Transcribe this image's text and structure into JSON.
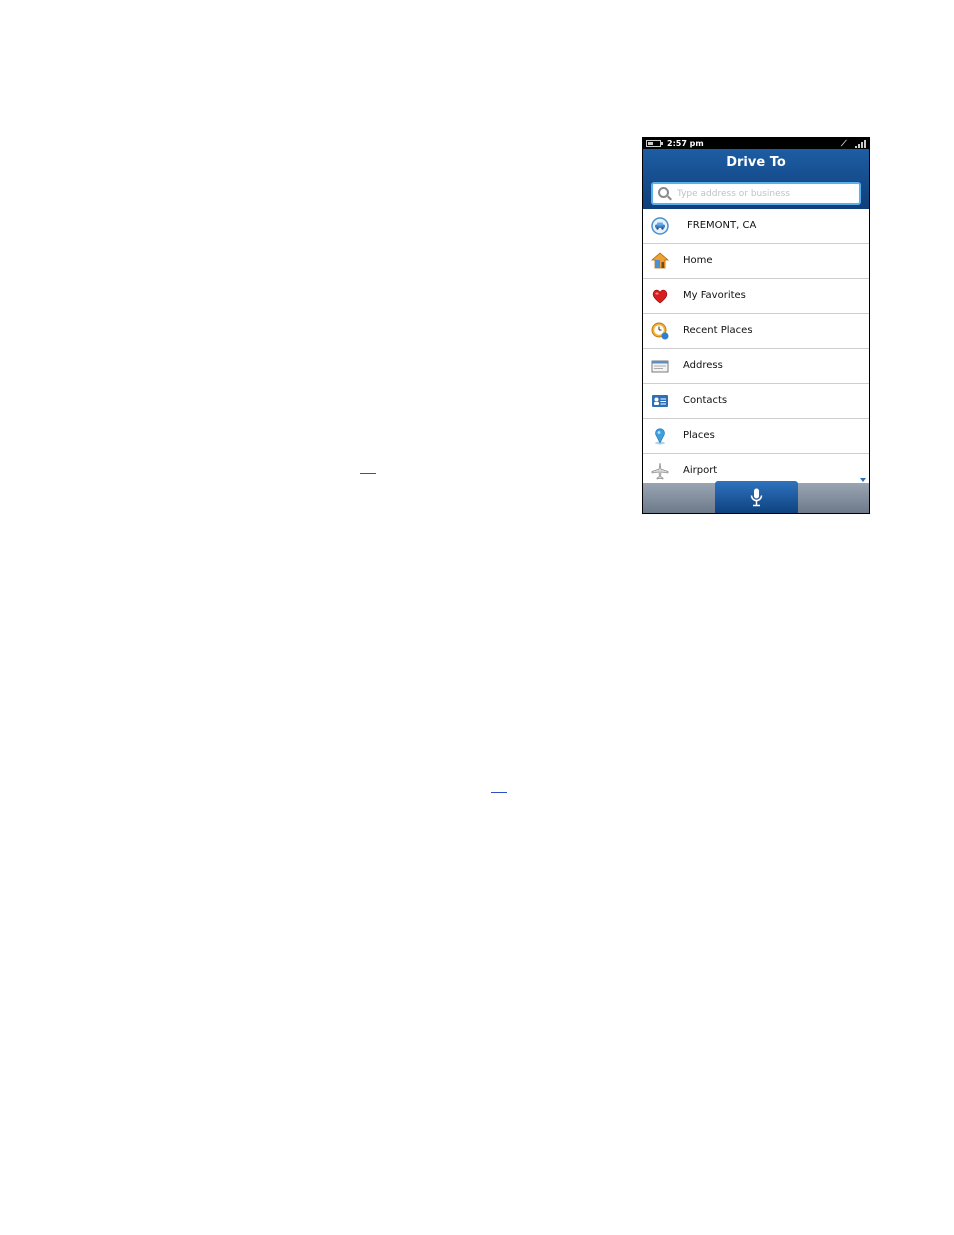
{
  "status_bar": {
    "time": "2:57 pm",
    "battery_icon": "battery-icon",
    "gps_icon": "gps-icon",
    "signal_icon": "signal-icon"
  },
  "header": {
    "title": "Drive To"
  },
  "search": {
    "placeholder": "Type address or business",
    "value": ""
  },
  "menu": {
    "items": [
      {
        "label": "FREMONT, CA",
        "icon": "car-location-icon"
      },
      {
        "label": "Home",
        "icon": "home-icon"
      },
      {
        "label": "My Favorites",
        "icon": "heart-icon"
      },
      {
        "label": "Recent Places",
        "icon": "clock-icon"
      },
      {
        "label": "Address",
        "icon": "address-card-icon"
      },
      {
        "label": "Contacts",
        "icon": "contacts-icon"
      },
      {
        "label": "Places",
        "icon": "pin-icon"
      },
      {
        "label": "Airport",
        "icon": "airplane-icon"
      }
    ]
  },
  "bottom_bar": {
    "mic_icon": "microphone-icon"
  },
  "colors": {
    "header_blue": "#0f3f7a",
    "search_border": "#5ab0ec",
    "accent_blue": "#2a6fb8",
    "bottom_bar": "#6d7a8a"
  }
}
